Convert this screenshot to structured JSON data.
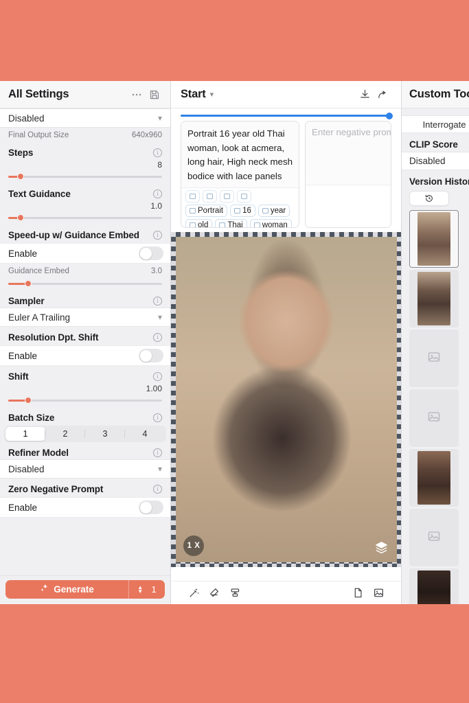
{
  "left_panel": {
    "title": "All Settings",
    "more_icon": "ellipsis-icon",
    "save_icon": "save-icon",
    "top_select_value": "Disabled",
    "final_output_size_label": "Final Output Size",
    "final_output_size_value": "640x960",
    "steps": {
      "label": "Steps",
      "value": "8",
      "pct": 8
    },
    "text_guidance": {
      "label": "Text Guidance",
      "value": "1.0",
      "pct": 8
    },
    "speedup": {
      "label": "Speed-up w/ Guidance Embed",
      "toggle_label": "Enable",
      "enabled": false
    },
    "guidance_embed": {
      "label": "Guidance Embed",
      "value": "3.0",
      "pct": 13
    },
    "sampler": {
      "label": "Sampler",
      "value": "Euler A Trailing"
    },
    "resolution_shift": {
      "label": "Resolution Dpt. Shift",
      "toggle_label": "Enable",
      "enabled": false
    },
    "shift": {
      "label": "Shift",
      "value": "1.00",
      "pct": 13
    },
    "batch_size": {
      "label": "Batch Size",
      "options": [
        "1",
        "2",
        "3",
        "4"
      ],
      "selected": 0
    },
    "refiner_model": {
      "label": "Refiner Model",
      "value": "Disabled"
    },
    "zero_negative_prompt": {
      "label": "Zero Negative Prompt",
      "toggle_label": "Enable",
      "enabled": false
    },
    "generate": {
      "label": "Generate",
      "icon": "sparkle-icon",
      "count": "1"
    }
  },
  "center_panel": {
    "title": "Start",
    "title_chevron": "chevron-down-icon",
    "download_icon": "download-icon",
    "share_icon": "share-icon",
    "progress_pct": 100,
    "prompt_text": "Portrait 16 year old Thai woman, look at acmera, long hair, High neck mesh bodice with lace panels",
    "prompt_chips": [
      "Portrait",
      "16",
      "year",
      "old",
      "Thai",
      "woman",
      ","
    ],
    "negative_placeholder": "Enter negative prompt",
    "zoom_badge": "1 X",
    "layers_icon": "layers-icon",
    "footer_icons_left": [
      "magic-wand-icon",
      "eraser-icon",
      "stamp-icon"
    ],
    "footer_icons_right": [
      "document-icon",
      "image-icon"
    ]
  },
  "right_panel": {
    "title": "Custom Tools",
    "interrogate_label": "Interrogate",
    "clip_score_label": "CLIP Score",
    "clip_score_value": "Disabled",
    "version_history_label": "Version History",
    "history_icon": "history-icon",
    "thumbnails": [
      {
        "kind": "image",
        "style": "photo-t1",
        "selected": true
      },
      {
        "kind": "image",
        "style": "photo-t2",
        "selected": false
      },
      {
        "kind": "placeholder",
        "selected": false
      },
      {
        "kind": "placeholder",
        "selected": false
      },
      {
        "kind": "image",
        "style": "photo-t3",
        "selected": false
      },
      {
        "kind": "placeholder",
        "selected": false
      },
      {
        "kind": "image",
        "style": "photo-t4",
        "selected": false
      }
    ]
  },
  "colors": {
    "accent": "#e8765c",
    "page_background": "#ec7f6a",
    "progress": "#2f82e8"
  }
}
